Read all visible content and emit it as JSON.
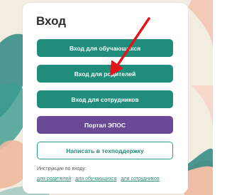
{
  "login": {
    "title": "Вход",
    "buttons": {
      "students": "Вход для обучающихся",
      "parents": "Вход для родителей",
      "staff": "Вход для сотрудников",
      "epos_portal": "Портал ЭПОС",
      "support": "Написать в техподдержку"
    },
    "instructions": {
      "label": "Инструкции по входу:",
      "links": [
        "для родителей",
        "для обучающихся",
        "для сотрудников"
      ]
    }
  },
  "colors": {
    "primary_teal": "#1f8c7c",
    "portal_purple": "#6a4a96",
    "annotation_red": "#e0161b"
  }
}
